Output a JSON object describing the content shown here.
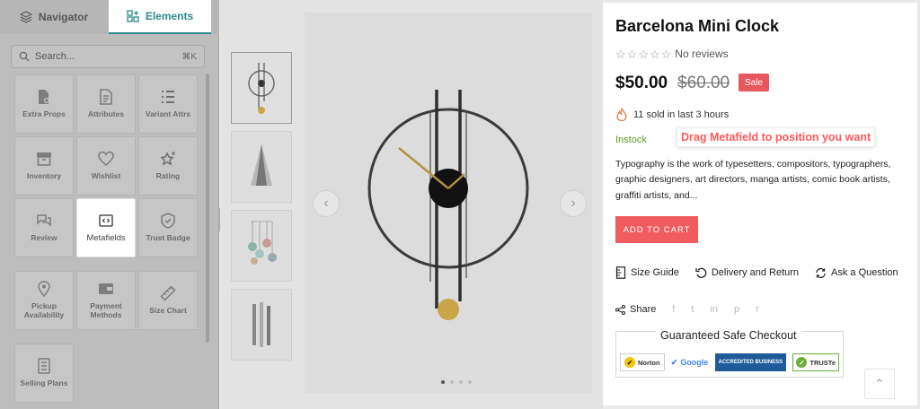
{
  "sidebar": {
    "tabs": [
      {
        "label": "Navigator",
        "icon": "layers-icon"
      },
      {
        "label": "Elements",
        "icon": "grid-plus-icon"
      }
    ],
    "search": {
      "placeholder": "Search...",
      "shortcut": "⌘K"
    },
    "elements": [
      {
        "label": "Extra Props",
        "icon": "file-props-icon"
      },
      {
        "label": "Attributes",
        "icon": "file-attributes-icon"
      },
      {
        "label": "Variant Attrs",
        "icon": "list-icon"
      },
      {
        "label": "Inventory",
        "icon": "archive-icon"
      },
      {
        "label": "Wishlist",
        "icon": "heart-icon"
      },
      {
        "label": "Rating",
        "icon": "star-sparkle-icon"
      },
      {
        "label": "Review",
        "icon": "chat-icon"
      },
      {
        "label": "Metafields",
        "icon": "code-icon"
      },
      {
        "label": "Trust Badge",
        "icon": "shield-check-icon"
      },
      {
        "label": "Pickup Availability",
        "icon": "map-pin-icon"
      },
      {
        "label": "Payment Methods",
        "icon": "wallet-icon"
      },
      {
        "label": "Size Chart",
        "icon": "ruler-icon"
      },
      {
        "label": "Selling Plans",
        "icon": "document-list-icon"
      }
    ]
  },
  "gallery": {
    "prev": "‹",
    "next": "›",
    "thumbnails": [
      "clock-thumbnail",
      "cone-lamp-thumbnail",
      "hanging-mobile-thumbnail",
      "wall-bars-thumbnail"
    ]
  },
  "product": {
    "title": "Barcelona Mini Clock",
    "reviews_text": "No reviews",
    "price": "$50.00",
    "compare_price": "$60.00",
    "sale_badge": "Sale",
    "sold_text": "11 sold in last 3 hours",
    "stock_status": "Instock",
    "drag_hint": "Drag Metafield to position you want",
    "description": "Typography is the work of typesetters, compositors, typographers, graphic designers, art directors, manga artists, comic book artists, graffiti artists, and...",
    "add_to_cart": "ADD TO CART",
    "links": {
      "size_guide": "Size Guide",
      "delivery": "Delivery and Return",
      "ask": "Ask a Question"
    },
    "share_label": "Share",
    "share_icons": [
      "f",
      "t",
      "in",
      "p",
      "r"
    ],
    "checkout_title": "Guaranteed Safe Checkout",
    "badges": {
      "norton": "Norton",
      "google": "Google",
      "bbb": "ACCREDITED BUSINESS",
      "truste": "TRUSTe"
    },
    "back_to_top": "⌃"
  },
  "colors": {
    "accent": "#2a8c8a",
    "sale": "#e8565e",
    "cart": "#ef5b5f",
    "instock": "#5aa02c",
    "hint": "#ff5a5a"
  }
}
